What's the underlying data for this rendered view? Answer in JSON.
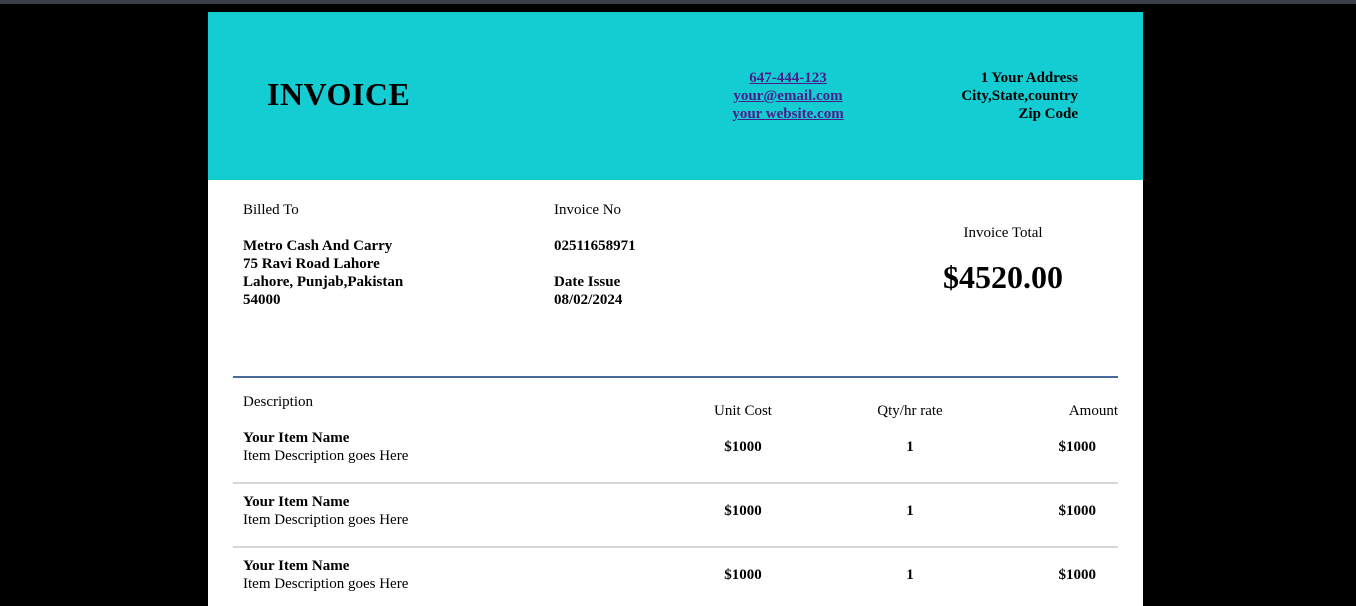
{
  "header": {
    "title": "INVOICE",
    "contact": {
      "phone": "647-444-123",
      "email": "your@email.com",
      "website": "your website.com"
    },
    "address": {
      "line1": "1 Your Address",
      "line2": "City,State,country",
      "line3": "Zip Code"
    },
    "background_color": "#14cdd3",
    "link_color": "#4b1e8c"
  },
  "billed_to": {
    "label": "Billed To",
    "name": "Metro Cash And Carry",
    "street": "75 Ravi Road Lahore",
    "city": "Lahore, Punjab,Pakistan",
    "zip": "54000"
  },
  "invoice_info": {
    "number_label": "Invoice No",
    "number": "02511658971",
    "date_label": "Date Issue",
    "date": "08/02/2024"
  },
  "total": {
    "label": "Invoice Total",
    "amount": "$4520.00"
  },
  "table": {
    "columns": {
      "description": "Description",
      "unit_cost": "Unit Cost",
      "qty": "Qty/hr rate",
      "amount": "Amount"
    },
    "rows": [
      {
        "name": "Your Item Name",
        "description": "Item Description goes Here",
        "unit_cost": "$1000",
        "qty": "1",
        "amount": "$1000"
      },
      {
        "name": "Your Item Name",
        "description": "Item Description goes Here",
        "unit_cost": "$1000",
        "qty": "1",
        "amount": "$1000"
      },
      {
        "name": "Your Item Name",
        "description": "Item Description goes Here",
        "unit_cost": "$1000",
        "qty": "1",
        "amount": "$1000"
      }
    ]
  }
}
